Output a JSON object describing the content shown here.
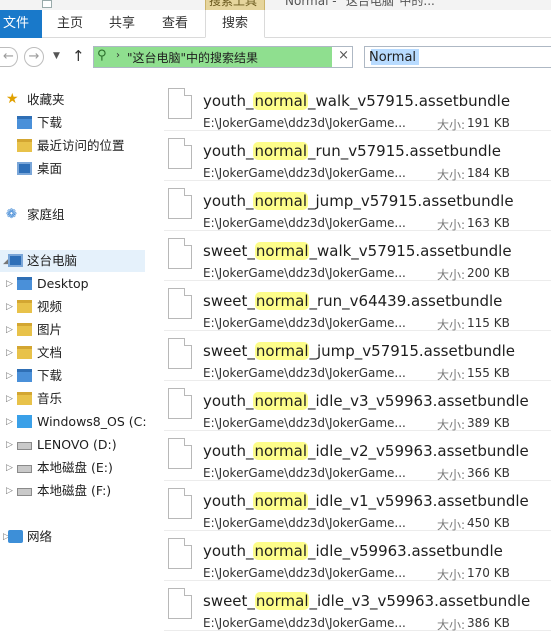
{
  "titlebar": {
    "context_tab_label": "搜索工具",
    "window_title": "Normal - \"这台电脑\"中的..."
  },
  "ribbon": {
    "tabs": [
      {
        "label": "文件"
      },
      {
        "label": "主页"
      },
      {
        "label": "共享"
      },
      {
        "label": "查看"
      },
      {
        "label": "搜索"
      }
    ]
  },
  "address_bar": {
    "path_text": "\"这台电脑\"中的搜索结果",
    "clear_glyph": "×",
    "search_value": "Normal"
  },
  "sidebar": {
    "items": [
      {
        "label": "收藏夹",
        "icon": "star-icon"
      },
      {
        "label": "下载",
        "icon": "downloads-folder-icon"
      },
      {
        "label": "最近访问的位置",
        "icon": "recent-places-icon"
      },
      {
        "label": "桌面",
        "icon": "desktop-icon"
      },
      {
        "label": "家庭组",
        "icon": "homegroup-icon"
      },
      {
        "label": "这台电脑",
        "icon": "this-pc-icon"
      },
      {
        "label": "Desktop",
        "icon": "folder-icon"
      },
      {
        "label": "视频",
        "icon": "videos-folder-icon"
      },
      {
        "label": "图片",
        "icon": "pictures-folder-icon"
      },
      {
        "label": "文档",
        "icon": "documents-folder-icon"
      },
      {
        "label": "下载",
        "icon": "downloads-folder-icon"
      },
      {
        "label": "音乐",
        "icon": "music-folder-icon"
      },
      {
        "label": "Windows8_OS (C:)",
        "icon": "windows-drive-icon"
      },
      {
        "label": "LENOVO (D:)",
        "icon": "drive-icon"
      },
      {
        "label": "本地磁盘 (E:)",
        "icon": "drive-icon"
      },
      {
        "label": "本地磁盘 (F:)",
        "icon": "drive-icon"
      },
      {
        "label": "网络",
        "icon": "network-icon"
      }
    ]
  },
  "results": {
    "size_label": "大小:",
    "highlight_term": "normal",
    "files": [
      {
        "prefix": "youth_",
        "suffix": "_walk_v57915.assetbundle",
        "path": "E:\\JokerGame\\ddz3d\\JokerGame...",
        "size": "191 KB"
      },
      {
        "prefix": "youth_",
        "suffix": "_run_v57915.assetbundle",
        "path": "E:\\JokerGame\\ddz3d\\JokerGame...",
        "size": "184 KB"
      },
      {
        "prefix": "youth_",
        "suffix": "_jump_v57915.assetbundle",
        "path": "E:\\JokerGame\\ddz3d\\JokerGame...",
        "size": "163 KB"
      },
      {
        "prefix": "sweet_",
        "suffix": "_walk_v57915.assetbundle",
        "path": "E:\\JokerGame\\ddz3d\\JokerGame...",
        "size": "200 KB"
      },
      {
        "prefix": "sweet_",
        "suffix": "_run_v64439.assetbundle",
        "path": "E:\\JokerGame\\ddz3d\\JokerGame...",
        "size": "115 KB"
      },
      {
        "prefix": "sweet_",
        "suffix": "_jump_v57915.assetbundle",
        "path": "E:\\JokerGame\\ddz3d\\JokerGame...",
        "size": "155 KB"
      },
      {
        "prefix": "youth_",
        "suffix": "_idle_v3_v59963.assetbundle",
        "path": "E:\\JokerGame\\ddz3d\\JokerGame...",
        "size": "389 KB"
      },
      {
        "prefix": "youth_",
        "suffix": "_idle_v2_v59963.assetbundle",
        "path": "E:\\JokerGame\\ddz3d\\JokerGame...",
        "size": "366 KB"
      },
      {
        "prefix": "youth_",
        "suffix": "_idle_v1_v59963.assetbundle",
        "path": "E:\\JokerGame\\ddz3d\\JokerGame...",
        "size": "450 KB"
      },
      {
        "prefix": "youth_",
        "suffix": "_idle_v59963.assetbundle",
        "path": "E:\\JokerGame\\ddz3d\\JokerGame...",
        "size": "170 KB"
      },
      {
        "prefix": "sweet_",
        "suffix": "_idle_v3_v59963.assetbundle",
        "path": "E:\\JokerGame\\ddz3d\\JokerGame...",
        "size": "386 KB"
      }
    ]
  },
  "colors": {
    "file_tab": "#1979ca",
    "address_fill": "#8fdf8f",
    "highlight": "#fdfd8a",
    "selected_nav": "#e5f1fb"
  }
}
